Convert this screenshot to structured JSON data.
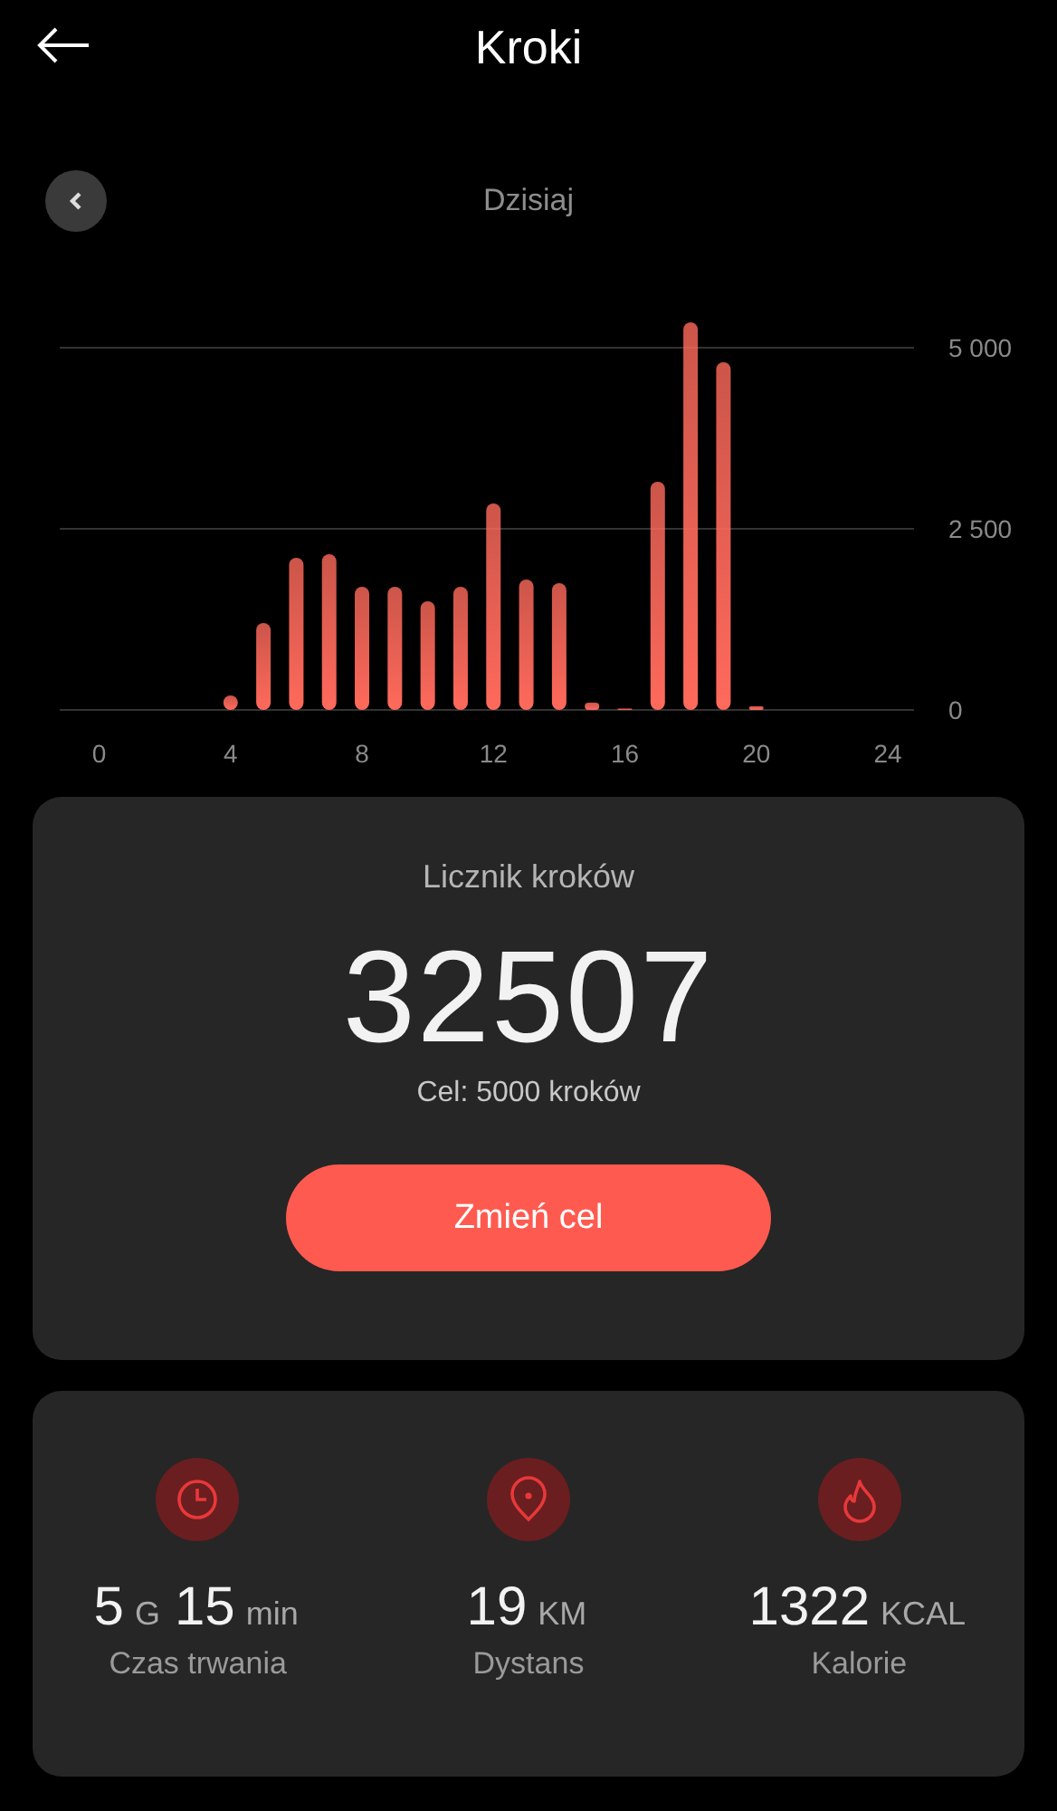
{
  "header": {
    "title": "Kroki"
  },
  "date_nav": {
    "label": "Dzisiaj"
  },
  "chart_data": {
    "type": "bar",
    "x": [
      4,
      5,
      6,
      7,
      8,
      9,
      10,
      11,
      12,
      13,
      14,
      15,
      16,
      17,
      18,
      19,
      20
    ],
    "series": [
      {
        "color": "#ff6a5c",
        "values": [
          200,
          1200,
          2100,
          2150,
          1700,
          1700,
          1500,
          1700,
          2850,
          1800,
          1750,
          100,
          20,
          3150,
          5350,
          4800,
          50
        ]
      }
    ],
    "xlim": [
      -1.2,
      24.8
    ],
    "ylim": [
      0,
      5350
    ],
    "xticks": [
      0,
      4,
      8,
      12,
      16,
      20,
      24
    ],
    "yticks": [
      0,
      {
        "value": 2500,
        "label": "2 500"
      },
      {
        "value": 5000,
        "label": "5 000"
      }
    ]
  },
  "counter": {
    "title": "Licznik kroków",
    "value": "32507",
    "goal": "Cel: 5000 kroków",
    "button": "Zmień cel"
  },
  "stats": [
    {
      "kind": "time",
      "parts": [
        {
          "kind": "number",
          "text": "5"
        },
        {
          "kind": "unit",
          "text": "G"
        },
        {
          "kind": "number",
          "text": "15"
        },
        {
          "kind": "unit",
          "text": "min"
        }
      ],
      "label": "Czas trwania"
    },
    {
      "kind": "distance",
      "parts": [
        {
          "kind": "number",
          "text": "19"
        },
        {
          "kind": "unit",
          "text": "KM"
        }
      ],
      "label": "Dystans"
    },
    {
      "kind": "calories",
      "parts": [
        {
          "kind": "number",
          "text": "1322"
        },
        {
          "kind": "unit",
          "text": "KCAL"
        }
      ],
      "label": "Kalorie"
    }
  ]
}
